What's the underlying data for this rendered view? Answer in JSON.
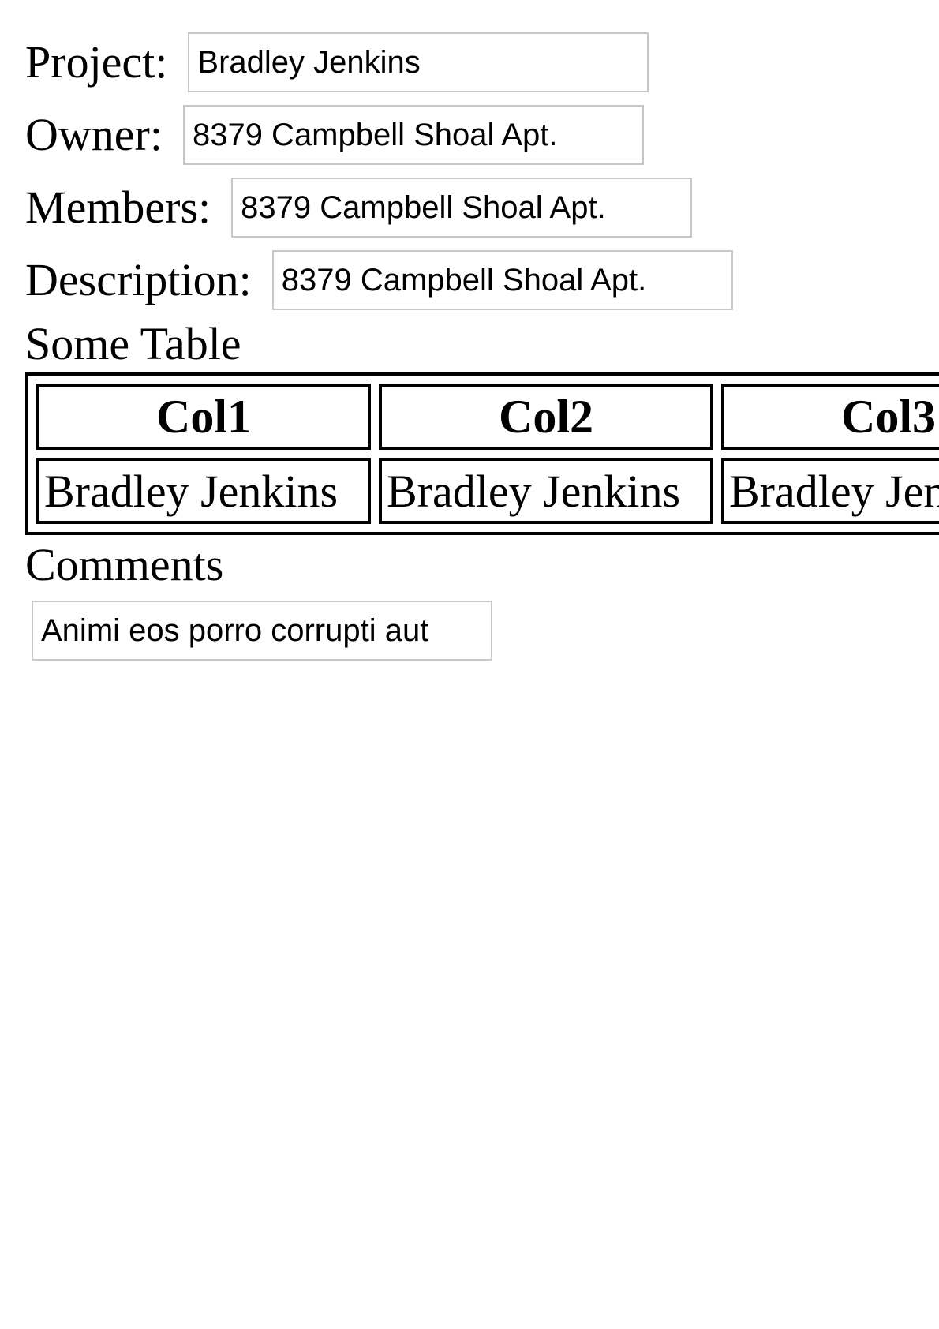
{
  "form": {
    "project": {
      "label": "Project:",
      "value": "Bradley Jenkins"
    },
    "owner": {
      "label": "Owner:",
      "value": "8379 Campbell Shoal Apt."
    },
    "members": {
      "label": "Members:",
      "value": "8379 Campbell Shoal Apt."
    },
    "description": {
      "label": "Description:",
      "value": "8379 Campbell Shoal Apt."
    }
  },
  "table": {
    "heading": "Some Table",
    "columns": [
      "Col1",
      "Col2",
      "Col3"
    ],
    "rows": [
      [
        "Bradley Jenkins",
        "Bradley Jenkins",
        "Bradley Jenkins"
      ]
    ]
  },
  "comments": {
    "heading": "Comments",
    "value": "Animi eos porro corrupti aut"
  }
}
